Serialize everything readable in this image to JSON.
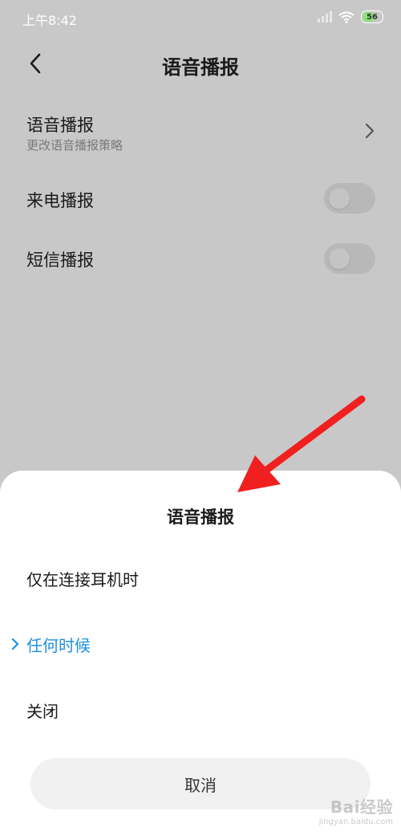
{
  "status_bar": {
    "time": "上午8:42",
    "battery": "56",
    "icons": [
      "signal-icon",
      "wifi-icon",
      "battery-icon"
    ]
  },
  "header": {
    "back_icon": "back-chevron-icon",
    "title": "语音播报"
  },
  "settings": [
    {
      "title": "语音播报",
      "subtitle": "更改语音播报策略",
      "control": "chevron-right-icon"
    },
    {
      "title": "来电播报",
      "control": "toggle",
      "on": false
    },
    {
      "title": "短信播报",
      "control": "toggle",
      "on": false
    }
  ],
  "sheet": {
    "title": "语音播报",
    "options": [
      {
        "label": "仅在连接耳机时",
        "selected": false
      },
      {
        "label": "任何时候",
        "selected": true
      },
      {
        "label": "关闭",
        "selected": false
      }
    ],
    "cancel_label": "取消"
  },
  "colors": {
    "dim_background": "#c8c8c8",
    "accent": "#1e90e0",
    "annotation_arrow": "#f02020"
  },
  "watermark": {
    "main": "Bai经验",
    "sub": "jingyan.baidu.com"
  }
}
